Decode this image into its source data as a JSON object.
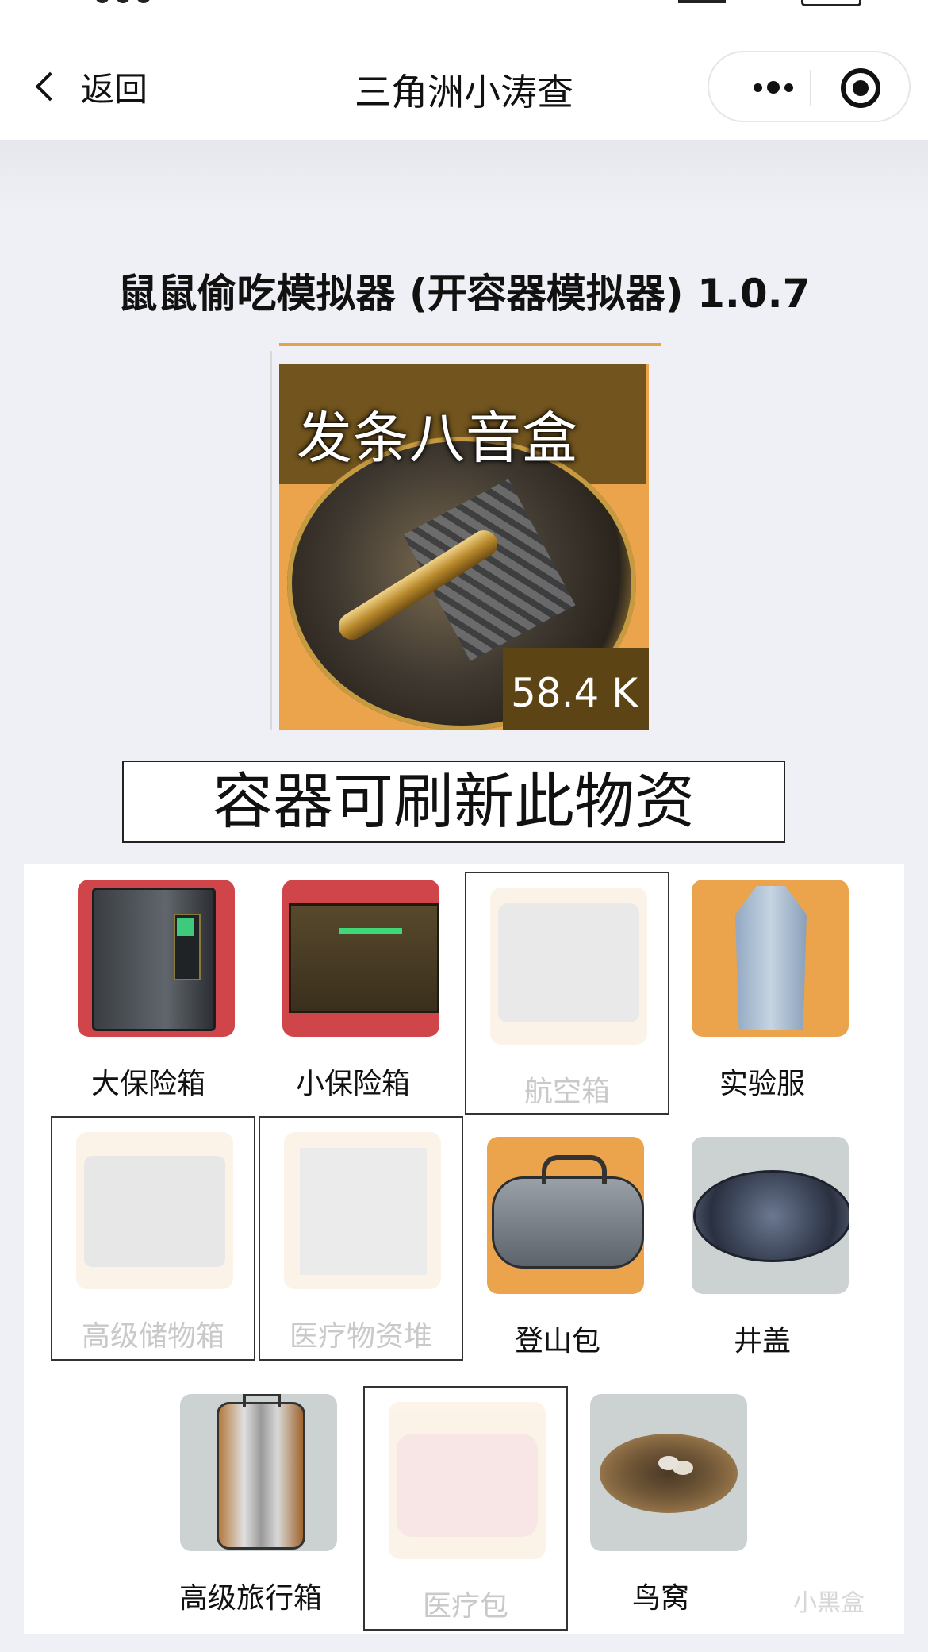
{
  "nav": {
    "back_label": "返回",
    "title": "三角洲小涛查"
  },
  "page": {
    "title": "鼠鼠偷吃模拟器 (开容器模拟器) 1.0.7"
  },
  "item": {
    "name": "发条八音盒",
    "price": "58.4 K"
  },
  "section_heading": "容器可刷新此物资",
  "containers": [
    {
      "label": "大保险箱",
      "available": true,
      "bg": "red",
      "icon": "big-safe-icon"
    },
    {
      "label": "小保险箱",
      "available": true,
      "bg": "red",
      "icon": "small-safe-icon"
    },
    {
      "label": "航空箱",
      "available": false,
      "bg": "orange",
      "icon": "aviation-case-icon"
    },
    {
      "label": "实验服",
      "available": true,
      "bg": "orange",
      "icon": "lab-coat-icon"
    },
    {
      "label": "高级储物箱",
      "available": false,
      "bg": "orange",
      "icon": "storage-crate-icon"
    },
    {
      "label": "医疗物资堆",
      "available": false,
      "bg": "orange",
      "icon": "medical-pile-icon"
    },
    {
      "label": "登山包",
      "available": true,
      "bg": "orange",
      "icon": "duffel-bag-icon"
    },
    {
      "label": "井盖",
      "available": true,
      "bg": "gray",
      "icon": "manhole-icon"
    },
    {
      "label": "高级旅行箱",
      "available": true,
      "bg": "gray",
      "icon": "suitcase-icon"
    },
    {
      "label": "医疗包",
      "available": false,
      "bg": "orange",
      "icon": "medkit-icon"
    },
    {
      "label": "鸟窝",
      "available": true,
      "bg": "gray",
      "icon": "bird-nest-icon"
    }
  ],
  "watermark": "小黑盒",
  "colors": {
    "red_bg": "#cf454a",
    "orange_bg": "#eba44c",
    "gray_bg": "#ccd1d2",
    "page_bg": "#eff0f5"
  }
}
